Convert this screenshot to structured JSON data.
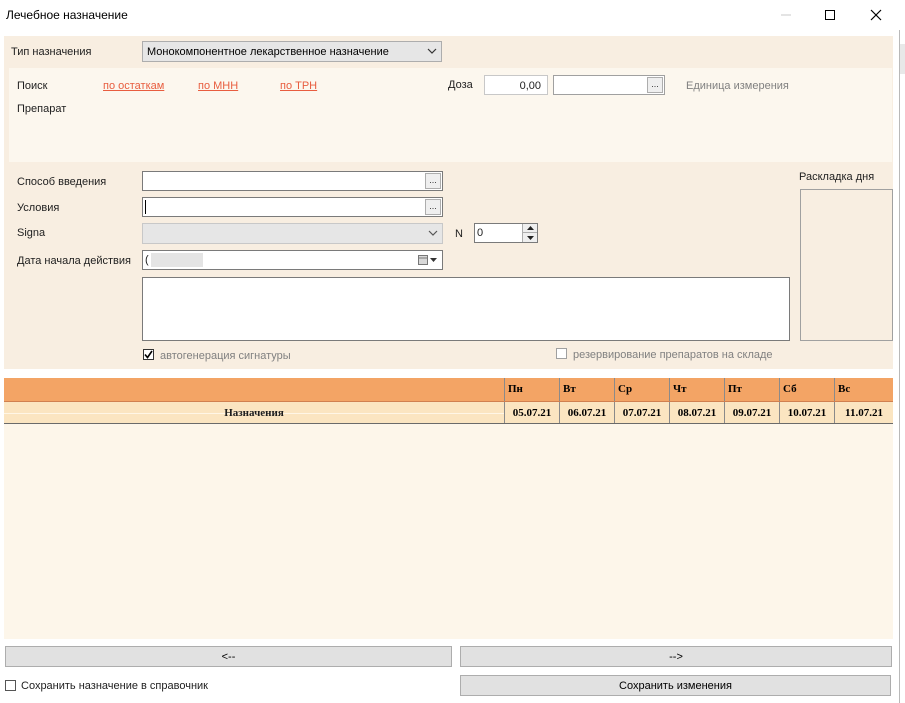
{
  "window": {
    "title": "Лечебное назначение"
  },
  "form": {
    "type_label": "Тип назначения",
    "type_value": "Монокомпонентное лекарственное назначение",
    "search_label": "Поиск",
    "search_links": [
      "по остаткам",
      "по МНН",
      "по ТРН"
    ],
    "dose_label": "Доза",
    "dose_value": "0,00",
    "unit_label": "Единица измерения",
    "drug_label": "Препарат",
    "route_label": "Способ введения",
    "conditions_label": "Условия",
    "signa_label": "Signa",
    "n_label": "N",
    "n_value": "0",
    "start_date_label": "Дата начала действия",
    "start_date_value": "(",
    "day_layout_label": "Раскладка дня",
    "autogen_label": "автогенерация сигнатуры",
    "autogen_checked": true,
    "reserve_label": "резервирование препаратов на складе",
    "reserve_checked": false,
    "browse_glyph": "..."
  },
  "schedule": {
    "row_label": "Назначения",
    "days": [
      {
        "day": "Пн",
        "date": "05.07.21"
      },
      {
        "day": "Вт",
        "date": "06.07.21"
      },
      {
        "day": "Ср",
        "date": "07.07.21"
      },
      {
        "day": "Чт",
        "date": "08.07.21"
      },
      {
        "day": "Пт",
        "date": "09.07.21"
      },
      {
        "day": "Сб",
        "date": "10.07.21"
      },
      {
        "day": "Вс",
        "date": "11.07.21"
      }
    ]
  },
  "footer": {
    "prev_label": "<--",
    "next_label": "-->",
    "save_to_ref_label": "Сохранить назначение в справочник",
    "save_to_ref_checked": false,
    "save_label": "Сохранить изменения"
  },
  "colors": {
    "panel_bg": "#f8eee1",
    "header_orange": "#f3a465",
    "date_row": "#fbe5c1",
    "link": "#e85d3f"
  }
}
